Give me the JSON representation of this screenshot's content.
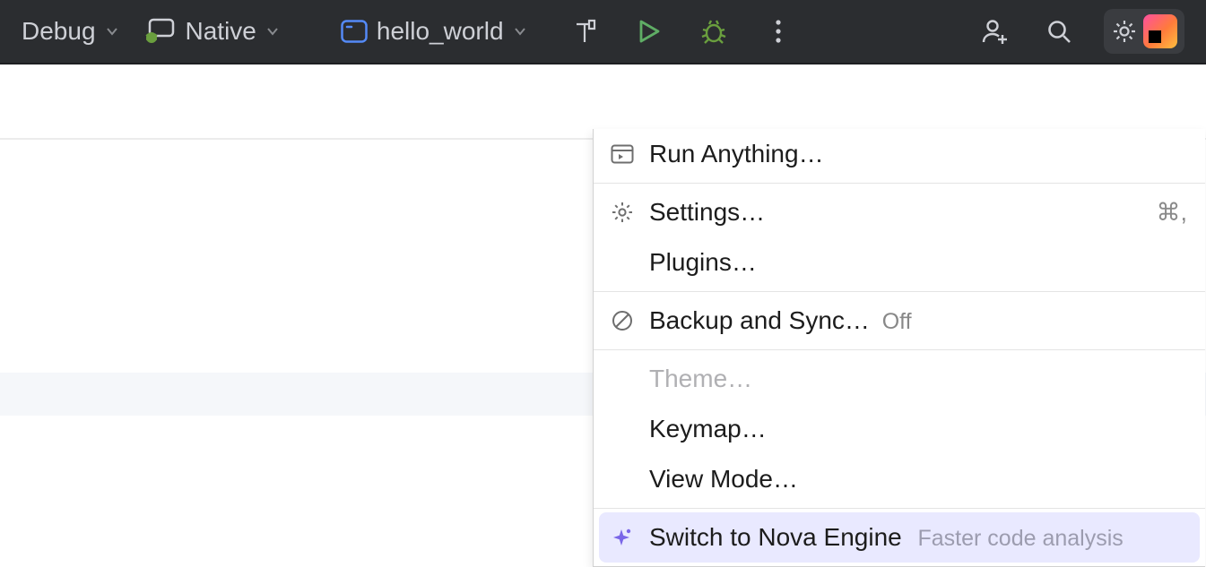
{
  "toolbar": {
    "build_mode": "Debug",
    "target": "Native",
    "run_config": "hello_world"
  },
  "settings_menu": {
    "run_anything": "Run Anything…",
    "settings": "Settings…",
    "settings_shortcut": "⌘,",
    "plugins": "Plugins…",
    "backup_sync": "Backup and Sync…",
    "backup_sync_state": "Off",
    "theme": "Theme…",
    "keymap": "Keymap…",
    "view_mode": "View Mode…",
    "nova_label": "Switch to Nova Engine",
    "nova_hint": "Faster code analysis"
  },
  "colors": {
    "run_green": "#5fad65",
    "debug_green": "#6a9f3e",
    "popup_highlight": "#e9e9ff"
  }
}
